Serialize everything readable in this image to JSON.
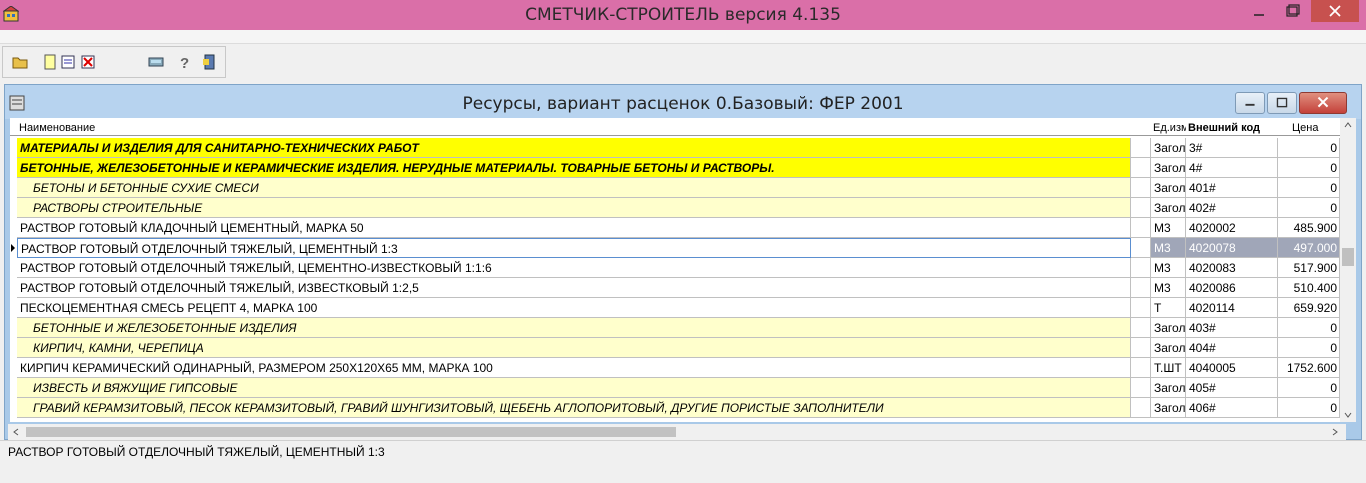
{
  "app": {
    "title": "СМЕТЧИК-СТРОИТЕЛЬ версия 4.135"
  },
  "window": {
    "title": "Ресурсы, вариант расценок 0.Базовый: ФЕР 2001"
  },
  "columns": {
    "name": "Наименование",
    "unit": "Ед.изм.",
    "code": "Внешний код",
    "price": "Цена"
  },
  "rows": [
    {
      "name": "МАТЕРИАЛЫ И ИЗДЕЛИЯ ДЛЯ САНИТАРНО-ТЕХНИЧЕСКИХ РАБОТ",
      "unit": "Загол",
      "code": "3#",
      "price": "0",
      "kind": "hdr1"
    },
    {
      "name": "БЕТОННЫЕ, ЖЕЛЕЗОБЕТОННЫЕ И КЕРАМИЧЕСКИЕ ИЗДЕЛИЯ. НЕРУДНЫЕ МАТЕРИАЛЫ. ТОВАРНЫЕ БЕТОНЫ И РАСТВОРЫ.",
      "unit": "Загол",
      "code": "4#",
      "price": "0",
      "kind": "hdr1"
    },
    {
      "name": "БЕТОНЫ И БЕТОННЫЕ СУХИЕ СМЕСИ",
      "unit": "Загол",
      "code": "401#",
      "price": "0",
      "kind": "hdr2"
    },
    {
      "name": "РАСТВОРЫ СТРОИТЕЛЬНЫЕ",
      "unit": "Загол",
      "code": "402#",
      "price": "0",
      "kind": "hdr2"
    },
    {
      "name": "РАСТВОР ГОТОВЫЙ КЛАДОЧНЫЙ ЦЕМЕНТНЫЙ, МАРКА 50",
      "unit": "М3",
      "code": "4020002",
      "price": "485.900",
      "kind": "item"
    },
    {
      "name": "РАСТВОР ГОТОВЫЙ ОТДЕЛОЧНЫЙ ТЯЖЕЛЫЙ, ЦЕМЕНТНЫЙ 1:3",
      "unit": "М3",
      "code": "4020078",
      "price": "497.000",
      "kind": "sel"
    },
    {
      "name": "РАСТВОР ГОТОВЫЙ ОТДЕЛОЧНЫЙ ТЯЖЕЛЫЙ, ЦЕМЕНТНО-ИЗВЕСТКОВЫЙ 1:1:6",
      "unit": "М3",
      "code": "4020083",
      "price": "517.900",
      "kind": "item"
    },
    {
      "name": "РАСТВОР ГОТОВЫЙ ОТДЕЛОЧНЫЙ ТЯЖЕЛЫЙ, ИЗВЕСТКОВЫЙ 1:2,5",
      "unit": "М3",
      "code": "4020086",
      "price": "510.400",
      "kind": "item"
    },
    {
      "name": "ПЕСКОЦЕМЕНТНАЯ СМЕСЬ РЕЦЕПТ  4, МАРКА 100",
      "unit": "Т",
      "code": "4020114",
      "price": "659.920",
      "kind": "item"
    },
    {
      "name": "БЕТОННЫЕ И ЖЕЛЕЗОБЕТОННЫЕ ИЗДЕЛИЯ",
      "unit": "Загол",
      "code": "403#",
      "price": "0",
      "kind": "hdr2"
    },
    {
      "name": "КИРПИЧ, КАМНИ, ЧЕРЕПИЦА",
      "unit": "Загол",
      "code": "404#",
      "price": "0",
      "kind": "hdr2"
    },
    {
      "name": "КИРПИЧ КЕРАМИЧЕСКИЙ ОДИНАРНЫЙ, РАЗМЕРОМ 250Х120Х65 ММ, МАРКА 100",
      "unit": "Т.ШТ",
      "code": "4040005",
      "price": "1752.600",
      "kind": "item"
    },
    {
      "name": "ИЗВЕСТЬ И ВЯЖУЩИЕ ГИПСОВЫЕ",
      "unit": "Загол",
      "code": "405#",
      "price": "0",
      "kind": "hdr2"
    },
    {
      "name": "ГРАВИЙ КЕРАМЗИТОВЫЙ, ПЕСОК КЕРАМЗИТОВЫЙ, ГРАВИЙ ШУНГИЗИТОВЫЙ, ЩЕБЕНЬ АГЛОПОРИТОВЫЙ, ДРУГИЕ ПОРИСТЫЕ ЗАПОЛНИТЕЛИ",
      "unit": "Загол",
      "code": "406#",
      "price": "0",
      "kind": "hdr2"
    }
  ],
  "status": {
    "text": "РАСТВОР ГОТОВЫЙ ОТДЕЛОЧНЫЙ ТЯЖЕЛЫЙ, ЦЕМЕНТНЫЙ 1:3"
  },
  "toolbar": {
    "icons": [
      "open-folder-icon",
      "new-document-icon",
      "edit-document-icon",
      "delete-document-icon",
      "calculator-icon",
      "help-icon",
      "exit-icon"
    ]
  },
  "colors": {
    "titlebar": "#da6fa8",
    "header_row": "#ffff00",
    "subheader_row": "#ffffcc",
    "selection": "#a0a6b8"
  }
}
